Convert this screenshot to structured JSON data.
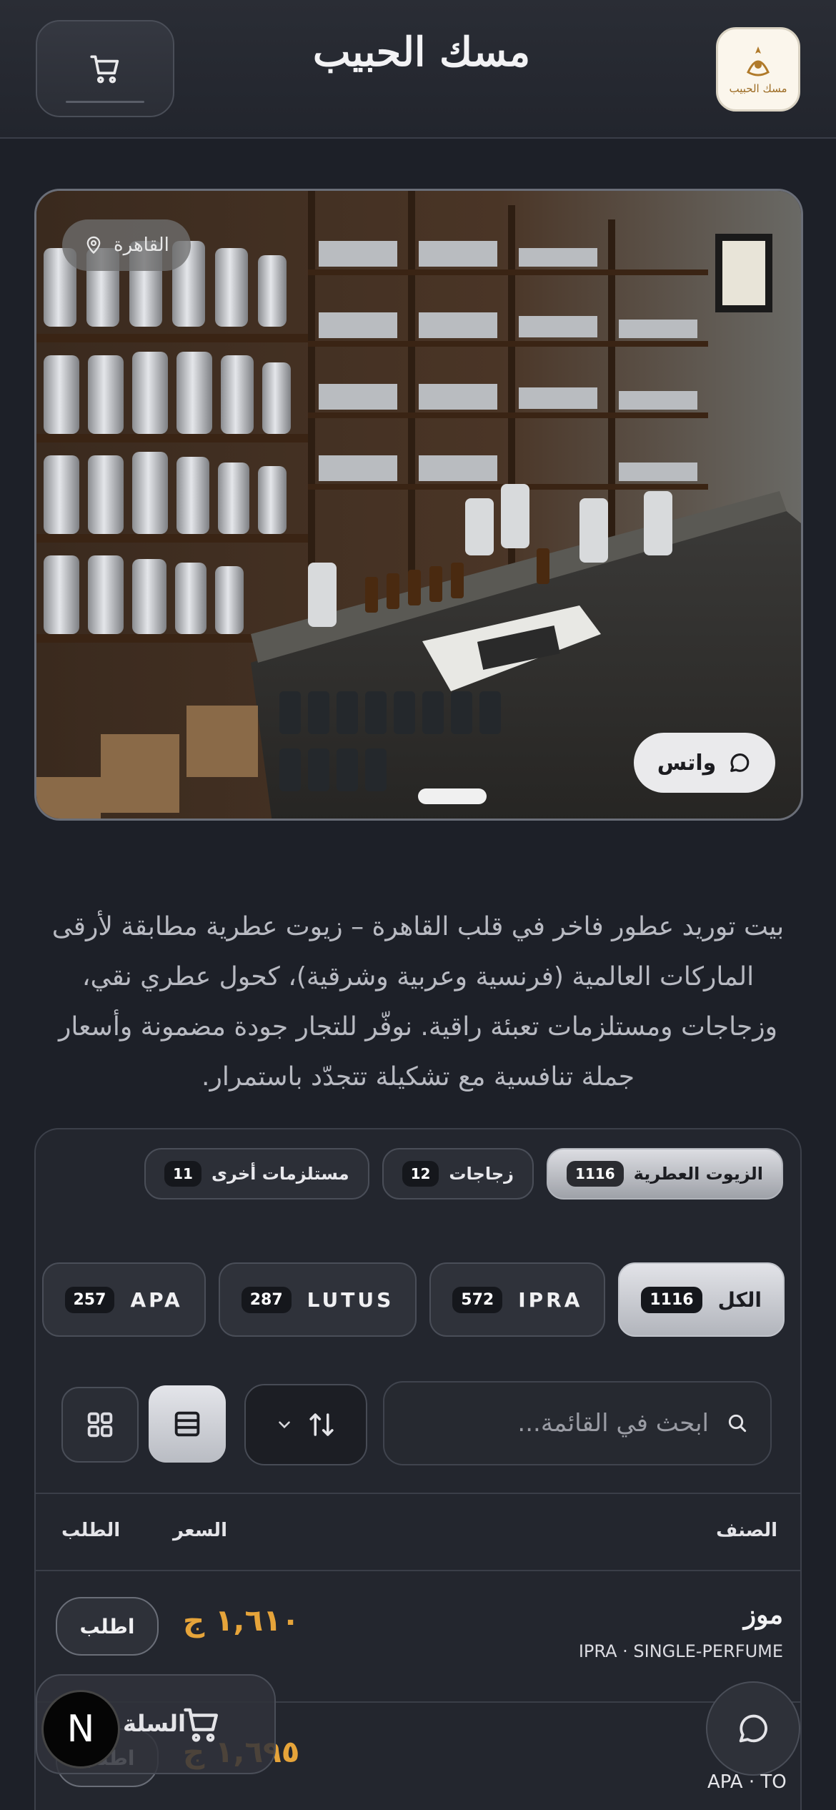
{
  "header": {
    "title": "مسك الحبيب",
    "logo_text": "مسك الحبيب",
    "cart_icon": "cart-icon"
  },
  "hero": {
    "location": "القاهرة",
    "whatsapp_label": "واتس"
  },
  "description": "بيت توريد عطور فاخر في قلب القاهرة – زيوت عطرية مطابقة لأرقى الماركات العالمية (فرنسية وعربية وشرقية)، كحول عطري نقي، وزجاجات ومستلزمات تعبئة راقية. نوفّر للتجار جودة مضمونة وأسعار جملة تنافسية مع تشكيلة تتجدّد باستمرار.",
  "categories": [
    {
      "label": "الزيوت العطرية",
      "count": "1116",
      "active": true
    },
    {
      "label": "زجاجات",
      "count": "12",
      "active": false
    },
    {
      "label": "مستلزمات أخرى",
      "count": "11",
      "active": false
    }
  ],
  "brands": [
    {
      "label": "الكل",
      "count": "1116",
      "active": true
    },
    {
      "label": "IPRA",
      "count": "572",
      "active": false
    },
    {
      "label": "LUTUS",
      "count": "287",
      "active": false
    },
    {
      "label": "APA",
      "count": "257",
      "active": false
    }
  ],
  "search": {
    "placeholder": "ابحث في القائمة..."
  },
  "table": {
    "col_item": "الصنف",
    "col_price": "السعر",
    "col_order": "الطلب"
  },
  "rows": [
    {
      "name": "موز",
      "sub": "IPRA · SINGLE-PERFUME",
      "price": "١,٦١٠ ج",
      "order": "اطلب"
    },
    {
      "name": "",
      "sub": "APA · TO",
      "price": "١,٦٩٥ ج",
      "order": "اطلب"
    }
  ],
  "floating": {
    "cart_label": "السلة",
    "n_badge": "N",
    "chat_icon": "chat-bubble-icon"
  },
  "colors": {
    "background": "#1d2028",
    "price": "#e6a43a",
    "active_tab": "#dcdde2"
  }
}
